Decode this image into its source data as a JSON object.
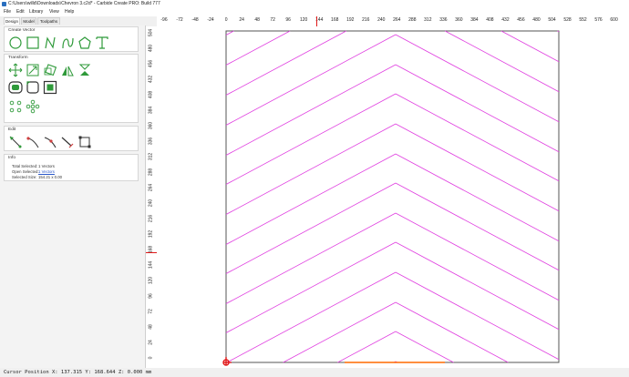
{
  "window": {
    "title": "C:\\Users\\willd\\Downloads\\Chevron 3.c2d* - Carbide Create PRO: Build 777"
  },
  "menu": {
    "file": "File",
    "edit": "Edit",
    "library": "Library",
    "view": "View",
    "help": "Help"
  },
  "tabs": {
    "design": "Design",
    "model": "Model",
    "toolpaths": "Toolpaths"
  },
  "sections": {
    "create_vector": "Create Vector",
    "transform": "Transform",
    "edit": "Edit",
    "info": "Info"
  },
  "info": {
    "total_selected_label": "Total Selected:",
    "total_selected_value": "1 Vectors",
    "open_selected_label": "Open Selected:",
    "open_selected_value": "1 Vectors",
    "selected_size_label": "Selected Size:",
    "selected_size_value": "154.21 x 0.00"
  },
  "ruler": {
    "h_ticks": [
      "-96",
      "-72",
      "-48",
      "-24",
      "0",
      "24",
      "48",
      "72",
      "96",
      "120",
      "144",
      "168",
      "192",
      "216",
      "240",
      "264",
      "288",
      "312",
      "336",
      "360",
      "384",
      "408",
      "432",
      "456",
      "480",
      "504",
      "528",
      "552",
      "576",
      "600"
    ],
    "v_ticks": [
      "504",
      "480",
      "456",
      "432",
      "408",
      "384",
      "360",
      "336",
      "312",
      "288",
      "264",
      "240",
      "216",
      "192",
      "168",
      "144",
      "120",
      "96",
      "72",
      "48",
      "24",
      "0"
    ]
  },
  "status": {
    "cursor": "Cursor Position X: 137.315 Y: 168.644 Z: 0.000 mm"
  },
  "colors": {
    "vector_lines": "#e040e0",
    "selected_vector": "#ff6a00",
    "cursor_marker": "#e01818",
    "icon_green": "#2f9a3a"
  },
  "icons": {
    "create_vector": [
      "circle-icon",
      "rectangle-icon",
      "polyline-icon",
      "curve-icon",
      "polygon-icon",
      "text-icon"
    ],
    "transform": [
      "move-icon",
      "scale-icon",
      "rotate-icon",
      "mirror-icon",
      "flip-icon",
      "offset-icon",
      "fillet-icon",
      "boolean-icon",
      "align-icon",
      "circle-array-icon",
      "grid-array-icon"
    ],
    "edit": [
      "node-edit-icon",
      "cut-icon",
      "join-icon",
      "trim-icon",
      "bounding-box-icon"
    ]
  }
}
